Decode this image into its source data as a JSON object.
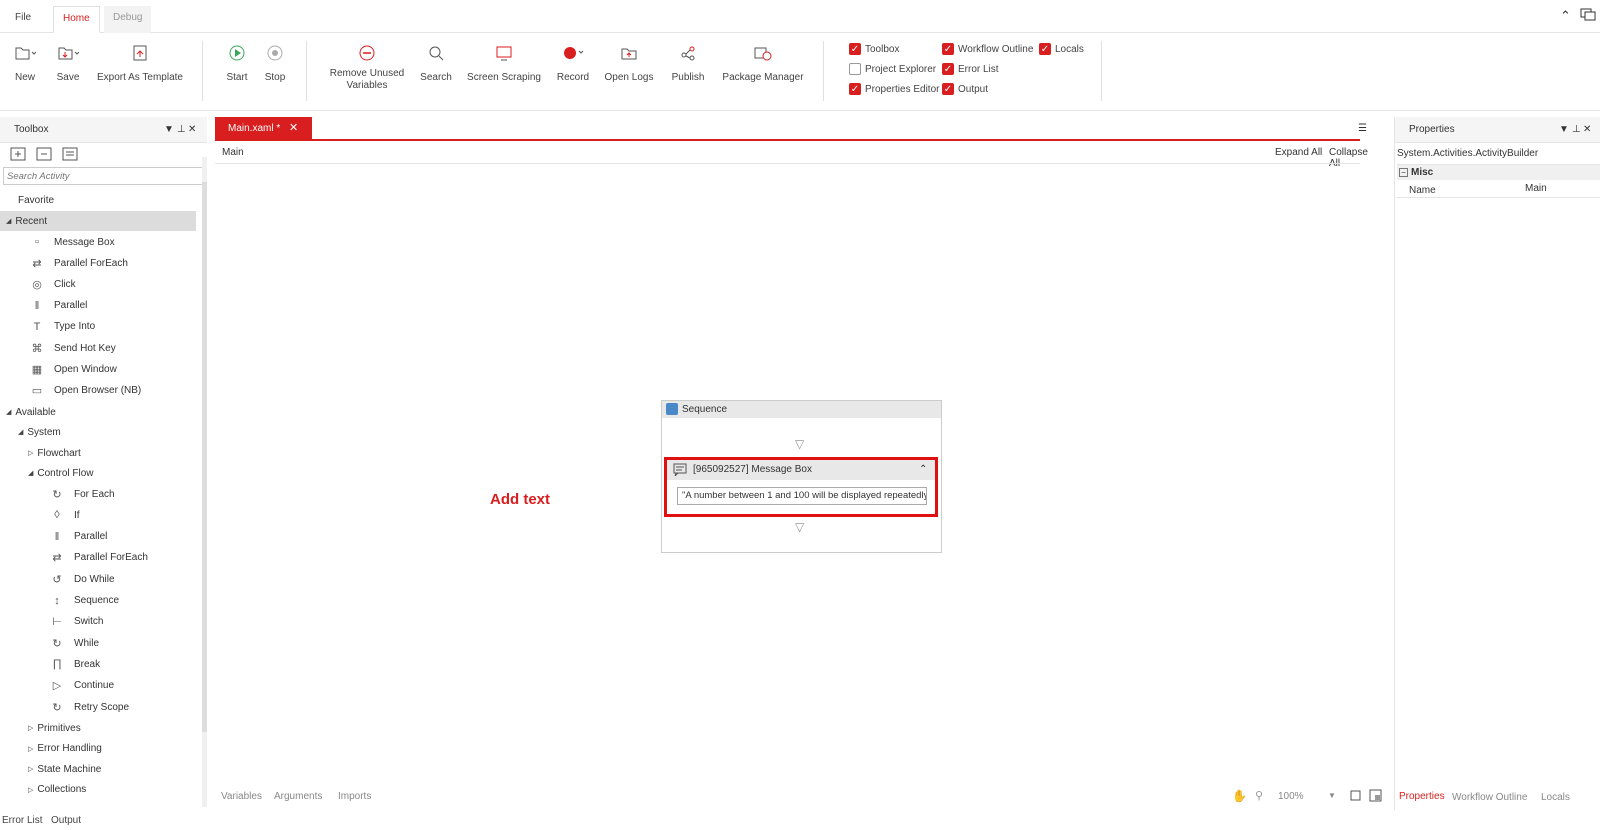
{
  "menubar": {
    "file": "File",
    "home": "Home",
    "debug": "Debug"
  },
  "ribbon": {
    "new": "New",
    "save": "Save",
    "export_template": "Export As Template",
    "start": "Start",
    "stop": "Stop",
    "remove_unused": "Remove Unused\nVariables",
    "remove_unused_1": "Remove Unused",
    "remove_unused_2": "Variables",
    "search": "Search",
    "screen_scraping": "Screen Scraping",
    "record": "Record",
    "open_logs": "Open Logs",
    "publish": "Publish",
    "package_manager": "Package Manager",
    "checks": {
      "toolbox": "Toolbox",
      "workflow_outline": "Workflow Outline",
      "locals": "Locals",
      "project_explorer": "Project Explorer",
      "error_list": "Error List",
      "properties_editor": "Properties Editor",
      "output": "Output"
    }
  },
  "toolbox": {
    "title": "Toolbox",
    "search_placeholder": "Search Activity",
    "favorite": "Favorite",
    "recent": "Recent",
    "recent_items": [
      "Message Box",
      "Parallel ForEach",
      "Click",
      "Parallel",
      "Type Into",
      "Send Hot Key",
      "Open Window",
      "Open Browser (NB)"
    ],
    "available": "Available",
    "system": "System",
    "flowchart": "Flowchart",
    "control_flow": "Control Flow",
    "control_items": [
      "For Each",
      "If",
      "Parallel",
      "Parallel ForEach",
      "Do While",
      "Sequence",
      "Switch",
      "While",
      "Break",
      "Continue",
      "Retry Scope"
    ],
    "other_groups": [
      "Primitives",
      "Error Handling",
      "State Machine",
      "Collections"
    ]
  },
  "designer": {
    "tab_label": "Main.xaml *",
    "breadcrumb": "Main",
    "expand_all": "Expand All",
    "collapse_all": "Collapse All",
    "sequence_title": "Sequence",
    "message_box_title": "[965092527] Message Box",
    "message_box_text": "\"A number between 1 and 100 will be displayed repeatedly",
    "annotation": "Add text",
    "bottom_tabs": [
      "Variables",
      "Arguments",
      "Imports"
    ],
    "zoom": "100%"
  },
  "properties": {
    "title": "Properties",
    "type": "System.Activities.ActivityBuilder",
    "section": "Misc",
    "name_label": "Name",
    "name_value": "Main",
    "bottom_tabs": [
      "Properties",
      "Workflow Outline",
      "Locals"
    ]
  },
  "status": {
    "error_list": "Error List",
    "output": "Output"
  },
  "colors": {
    "accent": "#d81e1e"
  }
}
